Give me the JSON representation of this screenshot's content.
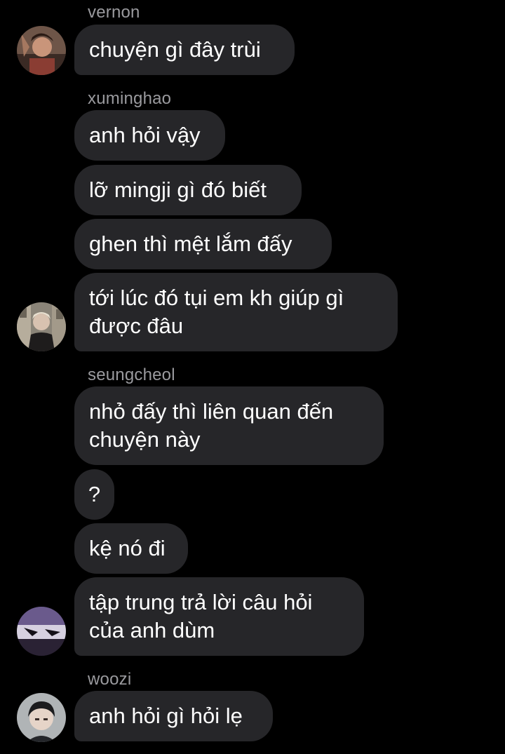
{
  "groups": [
    {
      "sender": "vernon",
      "messages": [
        "chuyện gì đây trùi"
      ]
    },
    {
      "sender": "xuminghao",
      "messages": [
        "anh hỏi vậy",
        "lỡ mingji gì đó biết",
        "ghen thì mệt lắm đấy",
        "tới lúc đó tụi em kh giúp gì được đâu"
      ]
    },
    {
      "sender": "seungcheol",
      "messages": [
        "nhỏ đấy thì liên quan đến chuyện này",
        "?",
        "kệ nó đi",
        "tập trung trả lời câu hỏi của anh dùm"
      ]
    },
    {
      "sender": "woozi",
      "messages": [
        "anh hỏi gì hỏi lẹ"
      ]
    }
  ],
  "colors": {
    "background": "#000000",
    "bubble": "#262629",
    "sender_name": "#9a9a9e",
    "text": "#ffffff"
  }
}
